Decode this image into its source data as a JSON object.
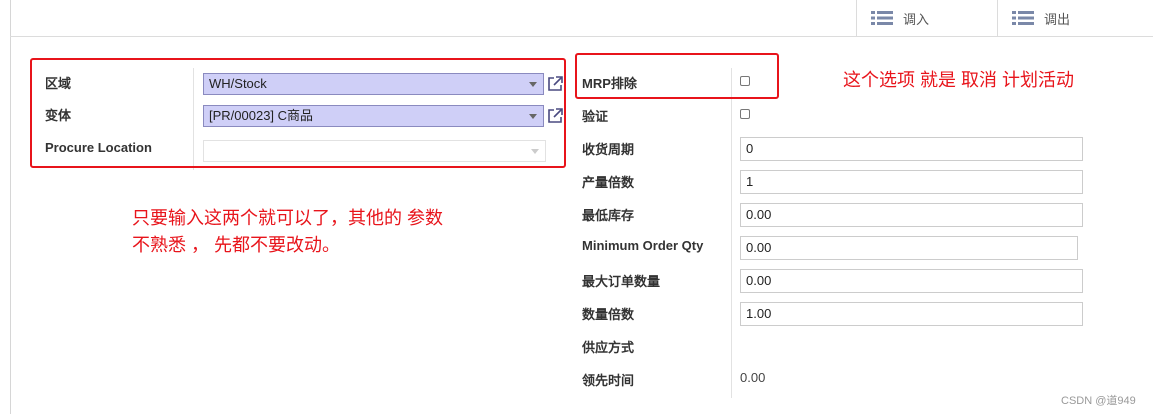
{
  "toolbar": {
    "transfer_in_label": "调入",
    "transfer_out_label": "调出"
  },
  "left_form": {
    "area_label": "区域",
    "area_value": "WH/Stock",
    "variant_label": "变体",
    "variant_value": "[PR/00023] C商品",
    "procure_location_label": "Procure Location",
    "procure_location_value": ""
  },
  "right_form": {
    "mrp_exclude_label": "MRP排除",
    "mrp_exclude_checked": false,
    "verify_label": "验证",
    "verify_checked": false,
    "receipt_cycle_label": "收货周期",
    "receipt_cycle_value": "0",
    "production_multiple_label": "产量倍数",
    "production_multiple_value": "1",
    "min_stock_label": "最低库存",
    "min_stock_value": "0.00",
    "min_order_qty_label": "Minimum Order Qty",
    "min_order_qty_value": "0.00",
    "max_order_qty_label": "最大订单数量",
    "max_order_qty_value": "0.00",
    "qty_multiple_label": "数量倍数",
    "qty_multiple_value": "1.00",
    "supply_method_label": "供应方式",
    "lead_time_label": "领先时间",
    "lead_time_value": "0.00"
  },
  "annotations": {
    "mrp_note": "这个选项 就是 取消 计划活动",
    "input_note_line1": "只要输入这两个就可以了，其他的 参数",
    "input_note_line2": "不熟悉 ， 先都不要改动。",
    "annotation_color": "#e8141b"
  },
  "watermark": "CSDN @道949",
  "colors": {
    "selected_field_bg": "#cfcff7",
    "selected_field_border": "#8a8abf"
  }
}
